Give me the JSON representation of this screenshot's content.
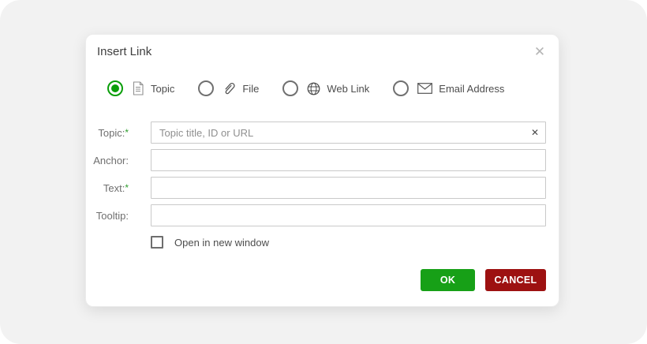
{
  "dialog": {
    "title": "Insert Link"
  },
  "icons": {
    "close": "✕",
    "clear": "✕"
  },
  "link_types": [
    {
      "label": "Topic",
      "icon": "document-icon",
      "selected": true
    },
    {
      "label": "File",
      "icon": "paperclip-icon",
      "selected": false
    },
    {
      "label": "Web Link",
      "icon": "globe-icon",
      "selected": false
    },
    {
      "label": "Email Address",
      "icon": "envelope-icon",
      "selected": false
    }
  ],
  "fields": [
    {
      "label": "Topic:",
      "required_mark": "*",
      "value": "",
      "placeholder": "Topic title, ID or URL",
      "has_clear_button": true
    },
    {
      "label": "Anchor:",
      "required_mark": "",
      "value": "",
      "placeholder": ""
    },
    {
      "label": "Text:",
      "required_mark": "*",
      "value": "",
      "placeholder": ""
    },
    {
      "label": "Tooltip:",
      "required_mark": "",
      "value": "",
      "placeholder": ""
    }
  ],
  "options": {
    "open_in_new_window": {
      "label": "Open in new window",
      "checked": false
    }
  },
  "actions": {
    "ok_label": "OK",
    "cancel_label": "CANCEL"
  },
  "colors": {
    "ok_green": "#17a017",
    "cancel_red": "#9d1111",
    "radio_selected_green": "#0a9e0a",
    "required_asterisk_green": "#2f9e2f"
  }
}
